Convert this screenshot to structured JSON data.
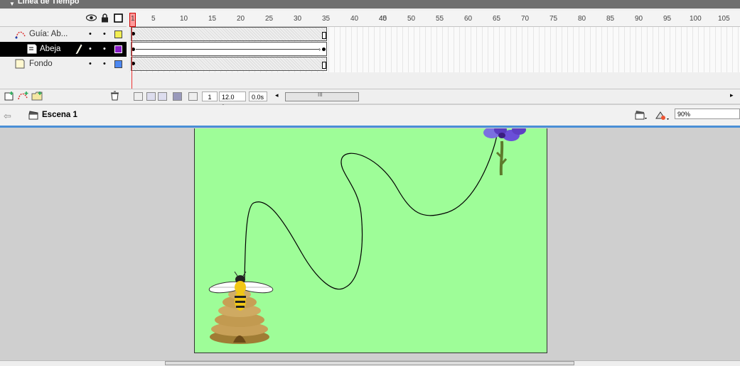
{
  "panel": {
    "title": "Línea de Tiempo"
  },
  "layers": [
    {
      "name": "Guía: Ab...",
      "color": "#f2ee52"
    },
    {
      "name": "Abeja",
      "color": "#8a1bc8"
    },
    {
      "name": "Fondo",
      "color": "#4d88f2"
    }
  ],
  "ruler": {
    "ticks": [
      "1",
      "5",
      "10",
      "15",
      "20",
      "25",
      "30",
      "35",
      "40",
      "45",
      "50",
      "55",
      "60",
      "65",
      "70",
      "75",
      "80",
      "85",
      "90",
      "95",
      "100",
      "105"
    ]
  },
  "status": {
    "frame": "1",
    "fps": "12.0 fps",
    "time": "0.0s"
  },
  "scene": {
    "label": "Escena 1",
    "zoom": "90%"
  },
  "icons": {
    "collapse": "triangle-down-icon",
    "eye": "eye-icon",
    "lock": "lock-icon",
    "outline": "outline-square-icon",
    "pencil": "pencil-icon",
    "trash": "trash-icon",
    "back": "arrow-left-icon",
    "clapper": "clapperboard-icon"
  },
  "colors": {
    "stage": "#9efd98",
    "selection": "#000000",
    "scene_border": "#4a8fd6",
    "playhead": "#ff6666"
  }
}
